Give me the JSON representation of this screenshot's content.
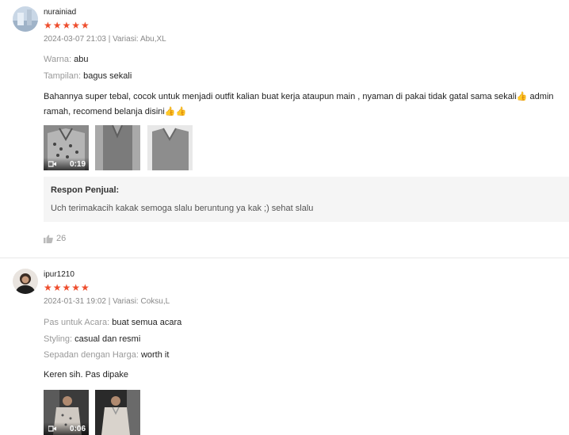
{
  "reviews": [
    {
      "username": "nurainiad",
      "stars": "★★★★★",
      "meta": "2024-03-07 21:03 | Variasi: Abu,XL",
      "attributes": [
        {
          "key": "Warna:",
          "value": "abu"
        },
        {
          "key": "Tampilan:",
          "value": "bagus sekali"
        }
      ],
      "body_line1": "Bahannya super tebal, cocok untuk menjadi outfit kalian buat kerja ataupun main , nyaman di pakai tidak gatal sama sekali👍 admin",
      "body_line2": "ramah, recomend belanja disini👍👍",
      "video_duration": "0:19",
      "seller_title": "Respon Penjual:",
      "seller_text": "Uch terimakacih kakak semoga slalu beruntung ya kak ;) sehat slalu",
      "likes": "26"
    },
    {
      "username": "ipur1210",
      "stars": "★★★★★",
      "meta": "2024-01-31 19:02 | Variasi: Coksu,L",
      "attributes": [
        {
          "key": "Pas untuk Acara:",
          "value": "buat semua acara"
        },
        {
          "key": "Styling:",
          "value": "casual dan resmi"
        },
        {
          "key": "Sepadan dengan Harga:",
          "value": "worth it"
        }
      ],
      "body_line1": "Keren sih. Pas dipake",
      "video_duration": "0:06"
    }
  ],
  "icons": {
    "star": "star-icon",
    "video": "video-camera-icon",
    "like": "thumbs-up-icon"
  },
  "colors": {
    "star": "#ee4d2d",
    "muted": "#999999",
    "seller_bg": "#f5f5f5"
  }
}
